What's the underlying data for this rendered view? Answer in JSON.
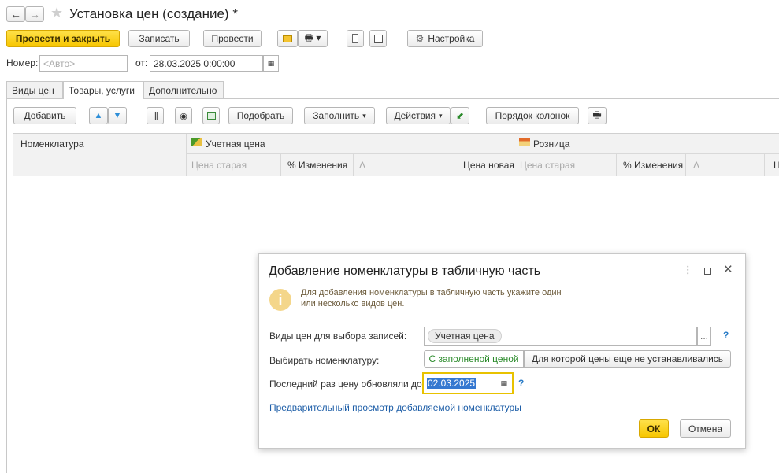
{
  "window": {
    "title": "Установка цен (создание) *"
  },
  "toolbar": {
    "post_close": "Провести и закрыть",
    "save": "Записать",
    "post": "Провести",
    "settings": "Настройка"
  },
  "header": {
    "number_label": "Номер:",
    "number_placeholder": "<Авто>",
    "date_label": "от:",
    "date_value": "28.03.2025  0:00:00"
  },
  "tabs": [
    "Виды цен",
    "Товары, услуги",
    "Дополнительно"
  ],
  "table_toolbar": {
    "add": "Добавить",
    "pick": "Подобрать",
    "fill": "Заполнить",
    "actions": "Действия",
    "column_order": "Порядок колонок"
  },
  "table": {
    "col_nomenclature": "Номенклатура",
    "group1": "Учетная цена",
    "group2": "Розница",
    "sub": [
      "Цена старая",
      "% Изменения",
      "Δ",
      "Цена новая",
      "Цена старая",
      "% Изменения",
      "Δ",
      "Ц"
    ]
  },
  "dialog": {
    "title": "Добавление номенклатуры в табличную часть",
    "info_line1": "Для добавления номенклатуры в табличную часть укажите один",
    "info_line2": "или несколько видов цен.",
    "price_types_label": "Виды цен для выбора записей:",
    "price_type_chip": "Учетная цена",
    "choose_label": "Выбирать номенклатуру:",
    "choice_with_price": "С заполненой ценой",
    "choice_without_price": "Для которой цены еще не устанавливались",
    "last_updated_label": "Последний раз цену обновляли до:",
    "last_updated_value": "02.03.2025",
    "preview_link": "Предварительный просмотр добавляемой номенклатуры",
    "ok": "ОК",
    "cancel": "Отмена",
    "ellipsis": "...",
    "help": "?"
  },
  "colors": {
    "primary": "#f7c600",
    "link": "#1f5fa8",
    "accent_green": "#2a8a2a",
    "focus": "#e8c200"
  },
  "icons": [
    "back-arrow-icon",
    "forward-arrow-icon",
    "favorite-star-icon",
    "mail-icon",
    "print-icon",
    "report-icon",
    "structure-icon",
    "settings-gear-icon",
    "move-up-icon",
    "move-down-icon",
    "barcode-icon",
    "eye-icon",
    "grid-icon",
    "export-icon",
    "print-table-icon",
    "info-icon",
    "calendar-icon",
    "dialog-menu-icon",
    "maximize-icon",
    "close-icon",
    "ruler-icon",
    "shop-icon"
  ]
}
